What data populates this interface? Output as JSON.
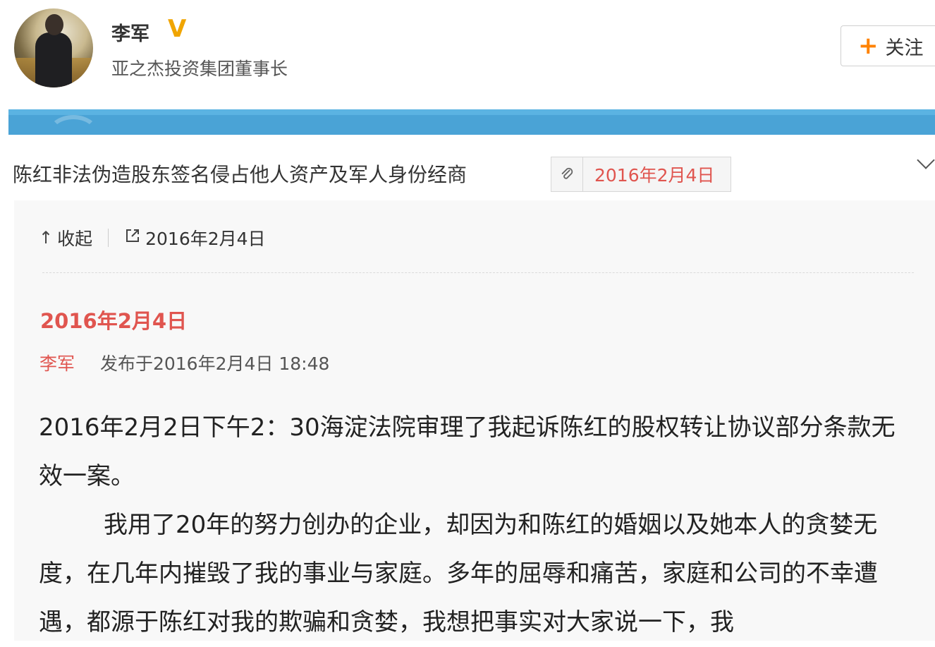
{
  "profile": {
    "name": "李军",
    "verified_mark": "V",
    "description": "亚之杰投资集团董事长",
    "follow_plus": "+",
    "follow_label": "关注"
  },
  "article": {
    "title": "陈红非法伪造股东签名侵占他人资产及军人身份经商",
    "tag_date": "2016年2月4日"
  },
  "toolbar": {
    "collapse_icon": "↑",
    "collapse_label": "收起",
    "open_icon": "⧉",
    "open_label": "2016年2月4日"
  },
  "post": {
    "date_heading": "2016年2月4日",
    "author": "李军",
    "published": "发布于2016年2月4日 18:48",
    "paragraphs": [
      "2016年2月2日下午2：30海淀法院审理了我起诉陈红的股权转让协议部分条款无效一案。",
      "我用了20年的努力创办的企业，却因为和陈红的婚姻以及她本人的贪婪无度，在几年内摧毁了我的事业与家庭。多年的屈辱和痛苦，家庭和公司的不幸遭遇，都源于陈红对我的欺骗和贪婪，我想把事实对大家说一下，我"
    ]
  },
  "icons": {
    "clip": "paperclip-icon",
    "collapse": "arrow-up-icon",
    "external": "external-link-icon",
    "chevron": "chevron-down-icon"
  },
  "colors": {
    "accent_red": "#e0554f",
    "follow_orange": "#ff8200",
    "banner_blue": "#4aa3d6",
    "verified_gold": "#f0a500"
  }
}
